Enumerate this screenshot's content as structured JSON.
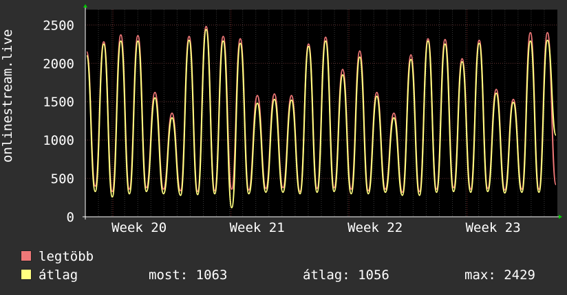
{
  "chart_data": {
    "type": "line",
    "ylabel": "onlinestream.live",
    "ylim": [
      0,
      2700
    ],
    "yticks": [
      0,
      500,
      1000,
      1500,
      2000,
      2500
    ],
    "x_tick_labels": [
      "Week 20",
      "Week 21",
      "Week 22",
      "Week 23"
    ],
    "grid": true,
    "series": [
      {
        "name": "legtöbb",
        "color": "#f07878",
        "values": [
          2150,
          400,
          2280,
          330,
          2370,
          360,
          2360,
          380,
          1620,
          360,
          1350,
          340,
          2350,
          330,
          2480,
          340,
          2350,
          360,
          2320,
          350,
          1580,
          370,
          1600,
          380,
          1580,
          330,
          2250,
          370,
          2340,
          380,
          1920,
          360,
          2160,
          340,
          1620,
          360,
          1350,
          320,
          2110,
          330,
          2320,
          360,
          2310,
          380,
          2060,
          360,
          2300,
          370,
          1660,
          350,
          1530,
          360,
          2400,
          360,
          2400,
          420
        ],
        "color_note": "max peaks"
      },
      {
        "name": "átlag",
        "color": "#ffff80",
        "values": [
          2100,
          330,
          2250,
          260,
          2290,
          300,
          2290,
          330,
          1550,
          300,
          1290,
          280,
          2300,
          290,
          2440,
          300,
          2290,
          120,
          2260,
          300,
          1480,
          320,
          1530,
          320,
          1520,
          300,
          2220,
          320,
          2290,
          330,
          1850,
          300,
          2080,
          300,
          1570,
          320,
          1290,
          280,
          2050,
          280,
          2290,
          320,
          2250,
          330,
          2020,
          320,
          2260,
          330,
          1610,
          310,
          1490,
          320,
          2290,
          320,
          2300,
          1063
        ]
      }
    ],
    "stats": {
      "most_label": "most:",
      "most_value": "1063",
      "atlag_label": "átlag:",
      "atlag_value": "1056",
      "max_label": "max:",
      "max_value": "2429"
    }
  },
  "legend": {
    "items": [
      {
        "label": "legtöbb",
        "color": "#f07878"
      },
      {
        "label": "átlag",
        "color": "#ffff80"
      }
    ]
  }
}
